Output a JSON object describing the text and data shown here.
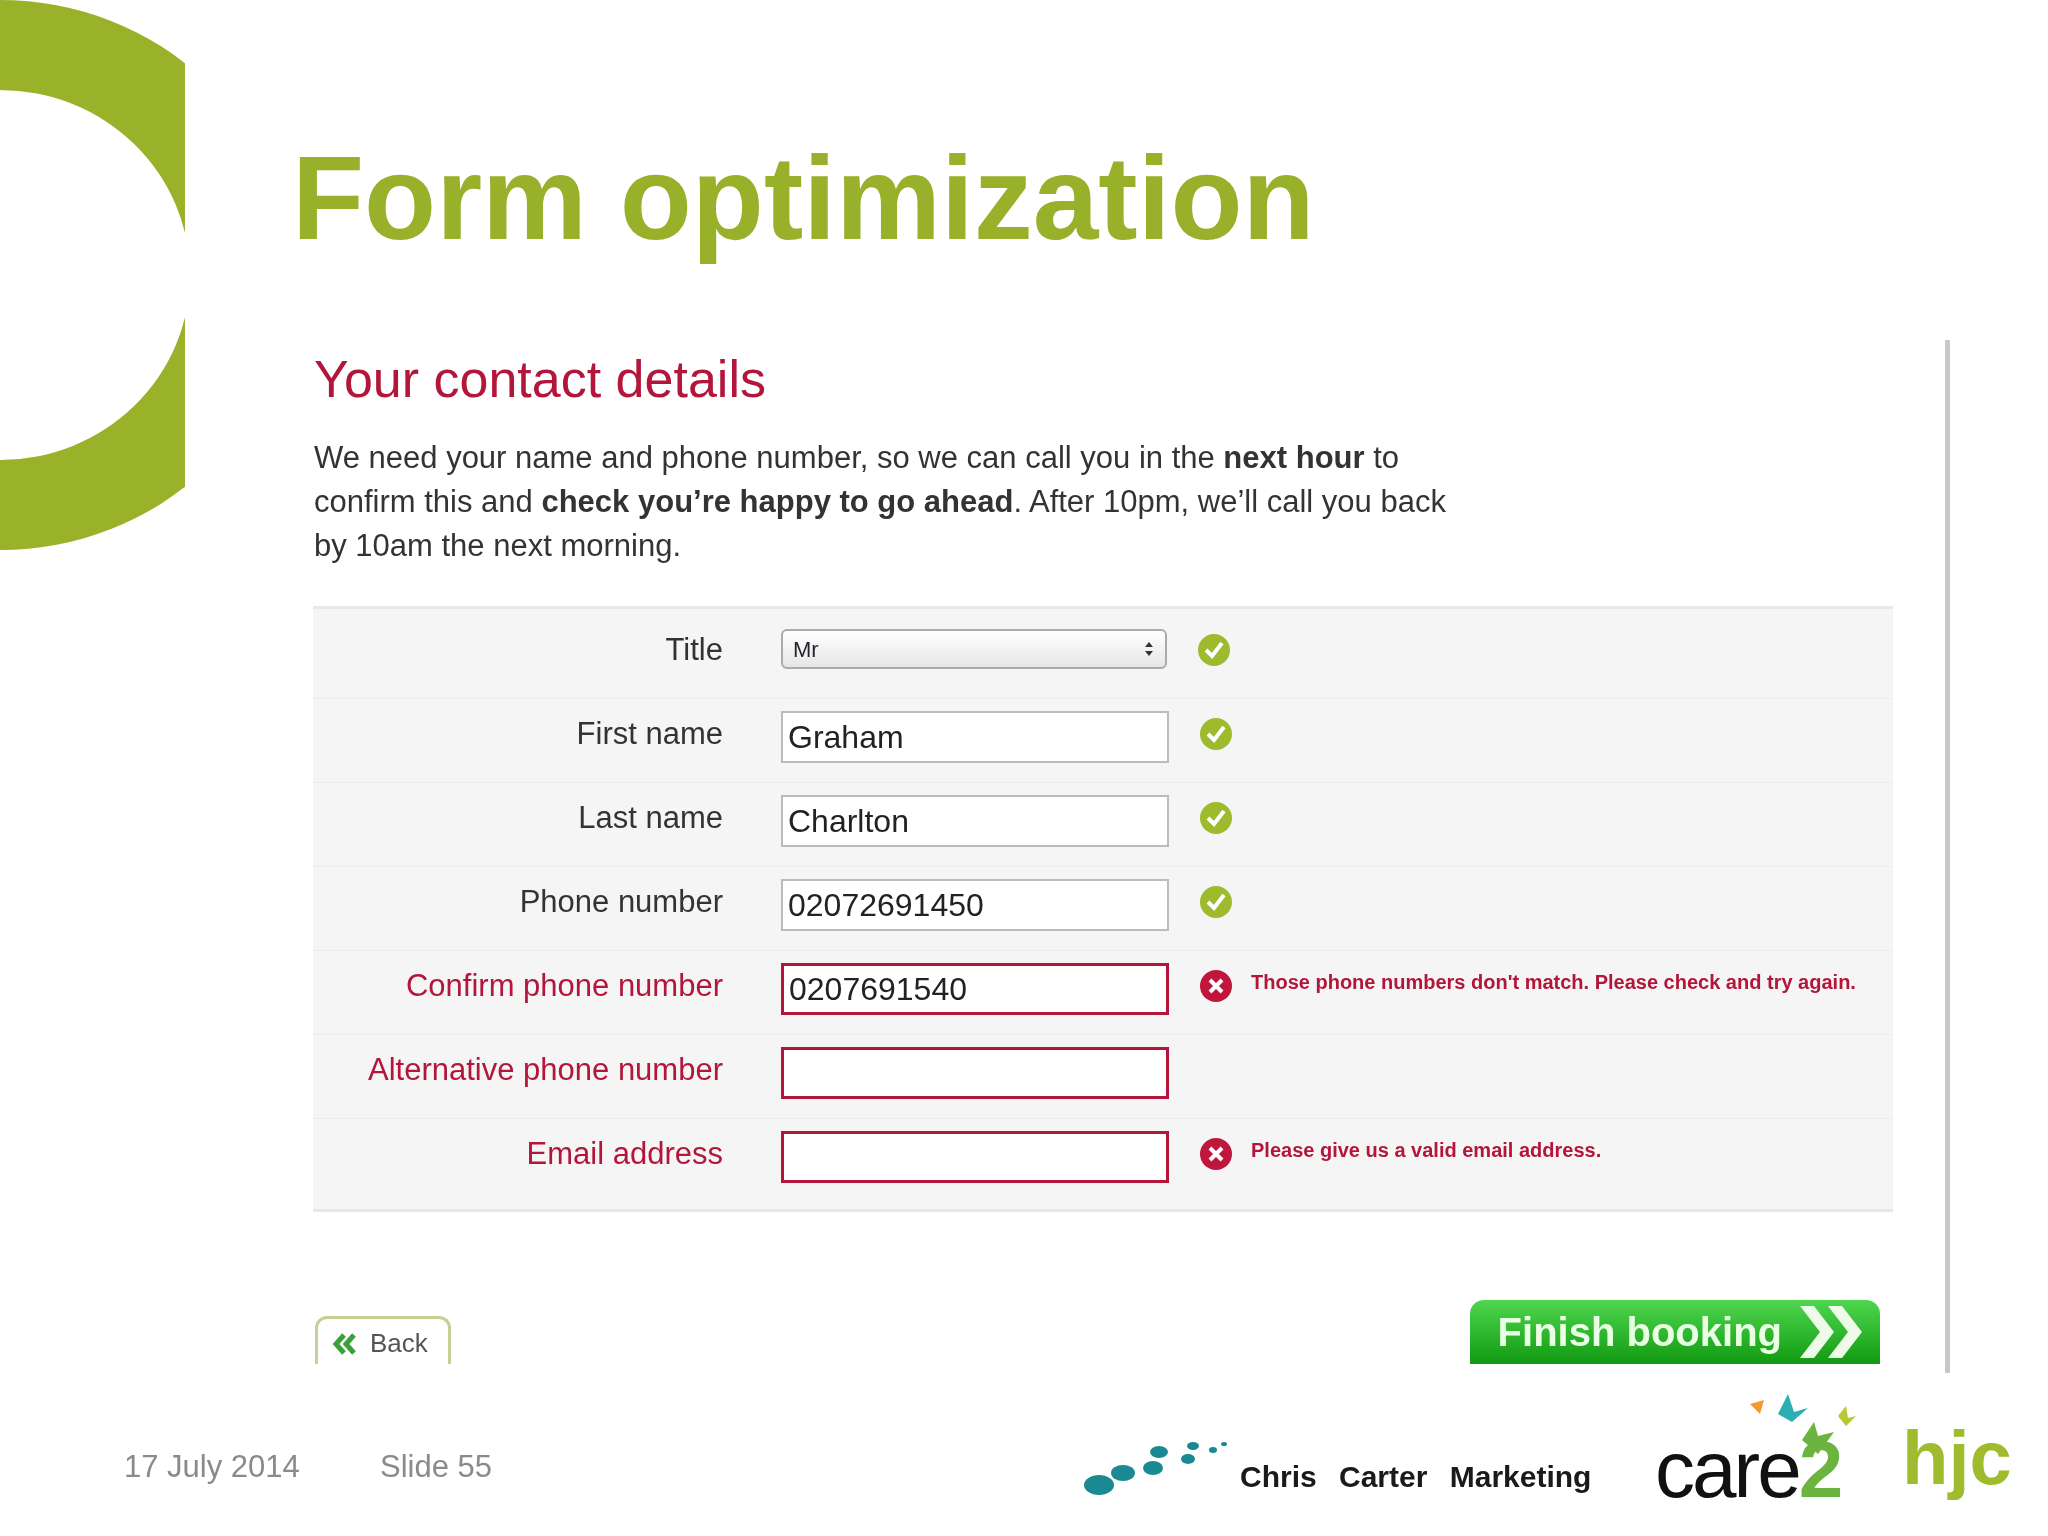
{
  "slide": {
    "title": "Form optimization",
    "date": "17 July 2014",
    "slide_number": "Slide 55"
  },
  "screenshot": {
    "heading": "Your contact details",
    "intro": "We need your name and phone number, so we can call you in the **next hour** to confirm this and **check you’re happy to go ahead**. After 10pm, we’ll call you back by 10am the next morning.",
    "fields": [
      {
        "label": "Title",
        "kind": "select",
        "value": "Mr",
        "invalid": false,
        "flagged": true
      },
      {
        "label": "First name",
        "kind": "text",
        "value": "Graham",
        "invalid": false,
        "flagged": true
      },
      {
        "label": "Last name",
        "kind": "text",
        "value": "Charlton",
        "invalid": false,
        "flagged": true
      },
      {
        "label": "Phone number",
        "kind": "text",
        "value": "02072691450",
        "invalid": false,
        "flagged": true
      },
      {
        "label": "Confirm phone number",
        "kind": "text",
        "value": "0207691540",
        "invalid": true,
        "flagged": true,
        "message": "Those phone numbers don't match. Please check and try again."
      },
      {
        "label": "Alternative phone number",
        "kind": "text",
        "invalid": true,
        "flagged": false
      },
      {
        "label": "Email address",
        "kind": "text",
        "invalid": true,
        "flagged": true,
        "message": "Please give us a valid email address."
      }
    ],
    "back_button": "Back",
    "finish_button": "Finish booking"
  },
  "logos": {
    "company": "Chris Carter Marketing",
    "care2": {
      "text": "care",
      "accent": "2"
    },
    "hjc": "hjc"
  }
}
